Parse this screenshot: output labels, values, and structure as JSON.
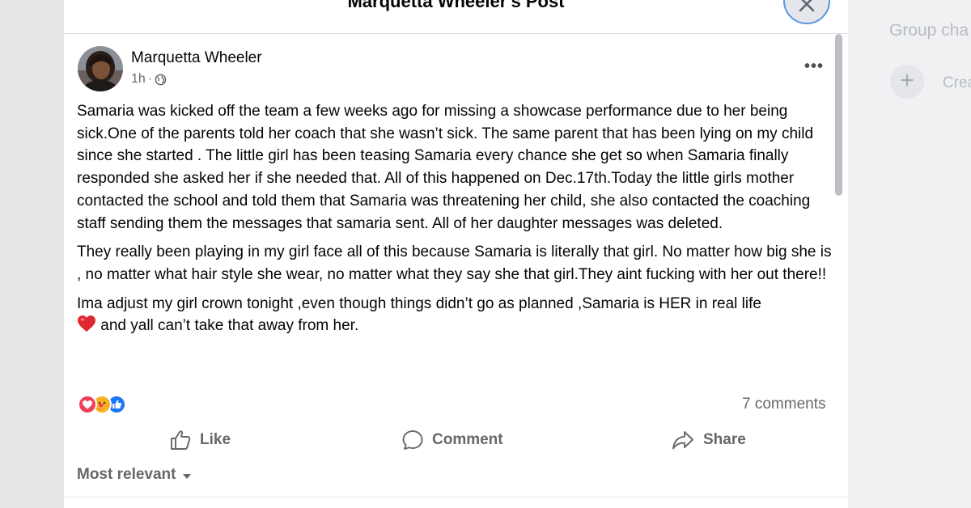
{
  "right_panel": {
    "title": "Group cha",
    "create_icon": "plus-icon",
    "create_label": "Crea"
  },
  "modal": {
    "title": "Marquetta Wheeler's Post",
    "close_icon": "close-icon"
  },
  "post": {
    "author": "Marquetta Wheeler",
    "time": "1h",
    "separator": "·",
    "privacy_icon": "globe-icon",
    "more_label": "•••",
    "paragraphs": [
      "Samaria was kicked off the team a few weeks ago for missing a showcase performance due to her being sick.One of the parents told her coach that she wasn’t sick.  The same parent that has been lying on my child since she started . The little girl has been teasing Samaria every chance she get so when Samaria finally responded she asked her if she needed that. All of this happened on Dec.17th.Today the little girls mother contacted the school and told them that Samaria was threatening her child, she also contacted the coaching staff  sending them the messages that samaria sent. All of her daughter messages was deleted.",
      "They really been playing in my girl face all of this because Samaria is literally that girl. No matter how big she is , no matter what hair style she wear, no matter  what they say she that girl.They aint fucking with her out there!!",
      "Ima adjust my girl crown tonight ,even though things didn’t go as planned ,Samaria is HER in real life"
    ],
    "last_line": "and yall can’t take that away from her.",
    "emoji": "red-heart-icon",
    "reactions": [
      "love-reaction-icon",
      "care-reaction-icon",
      "like-reaction-icon"
    ],
    "comments_count": "7 comments"
  },
  "actions": {
    "like": "Like",
    "comment": "Comment",
    "share": "Share"
  },
  "sort": {
    "label": "Most relevant"
  },
  "colors": {
    "secondary_text": "#65676b",
    "like_blue": "#1877f2",
    "love_red": "#f33e58",
    "care_yellow": "#f7b125"
  }
}
